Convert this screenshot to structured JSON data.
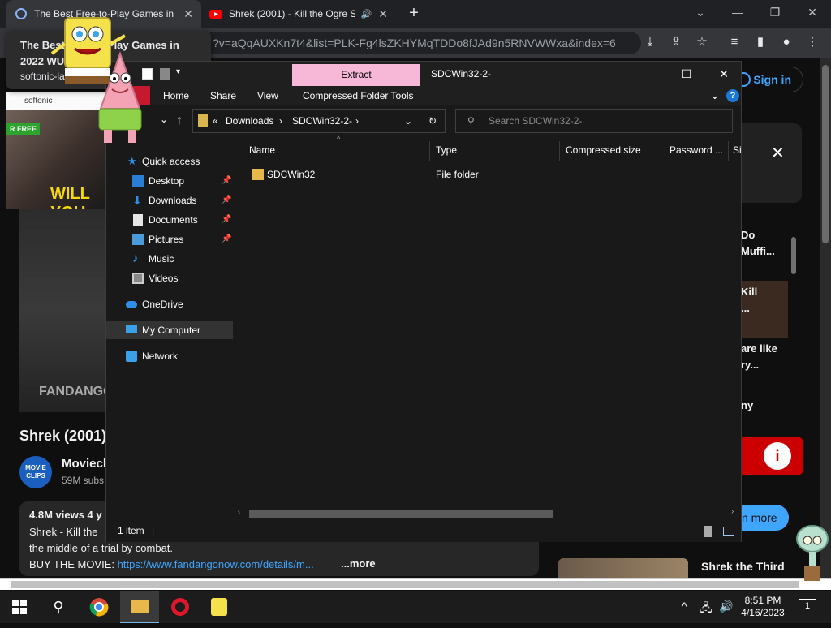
{
  "browser": {
    "tabs": [
      {
        "title": "The Best Free-to-Play Games in 2",
        "icon": "softonic-icon"
      },
      {
        "title": "Shrek (2001) - Kill the Ogre S",
        "icon": "youtube-icon"
      }
    ],
    "url": "?v=aQqAUXKn7t4&list=PLK-Fg4lsZKHYMqTDDo8fJAd9n5RNVWWxa&index=6",
    "tooltip": {
      "title": "The Best Free-to-Play Games in 2022 WU",
      "url": "softonic-labs.co..."
    }
  },
  "youtube": {
    "signin": "Sign in",
    "video_title": "Shrek (2001)",
    "channel": {
      "name": "Moviecl",
      "subs": "59M subs",
      "avatar_text": "MOVIE CLIPS"
    },
    "views": "4.8M views  4 y",
    "desc_lines": [
      "Shrek - Kill the",
      "the middle of a trial by combat."
    ],
    "buy_label": "BUY THE MOVIE: ",
    "buy_link": "https://www.fandangonow.com/details/m...",
    "more": "...more",
    "fandango": "FANDANGO MOVIEC",
    "video_banner": "WILL YOU",
    "free_badge": "R FREE",
    "side": {
      "s1": "Do",
      "s2": "Muffi...",
      "s3": "Kill",
      "s4": "...",
      "s5": "are like",
      "s6": "ry...",
      "s7": "ny"
    },
    "learn_more": "n more",
    "next_title": "Shrek the Third"
  },
  "explorer": {
    "extract_tab": "Extract",
    "window_title": "SDCWin32-2-",
    "ribbon": {
      "home": "Home",
      "share": "Share",
      "view": "View",
      "tools": "Compressed Folder Tools"
    },
    "address": {
      "prefix": "«",
      "seg1": "Downloads",
      "sep": "›",
      "seg2": "SDCWin32-2-"
    },
    "search_placeholder": "Search SDCWin32-2-",
    "nav": [
      {
        "label": "Quick access",
        "icon": "star-icon"
      },
      {
        "label": "Desktop",
        "icon": "desktop-icon",
        "pinned": true
      },
      {
        "label": "Downloads",
        "icon": "download-icon",
        "pinned": true
      },
      {
        "label": "Documents",
        "icon": "document-icon",
        "pinned": true
      },
      {
        "label": "Pictures",
        "icon": "pictures-icon",
        "pinned": true
      },
      {
        "label": "Music",
        "icon": "music-icon"
      },
      {
        "label": "Videos",
        "icon": "video-icon"
      },
      {
        "label": "OneDrive",
        "icon": "cloud-icon"
      },
      {
        "label": "My Computer",
        "icon": "computer-icon"
      },
      {
        "label": "Network",
        "icon": "network-icon"
      }
    ],
    "columns": [
      "Name",
      "Type",
      "Compressed size",
      "Password ...",
      "Si"
    ],
    "files": [
      {
        "name": "SDCWin32",
        "type": "File folder"
      }
    ],
    "status": "1 item"
  },
  "taskbar": {
    "time": "8:51 PM",
    "date": "4/16/2023",
    "notif_count": "1"
  },
  "colors": {
    "accent": "#3ea6ff",
    "extract_tab": "#f7b7d6",
    "yt_red": "#cc0000"
  }
}
